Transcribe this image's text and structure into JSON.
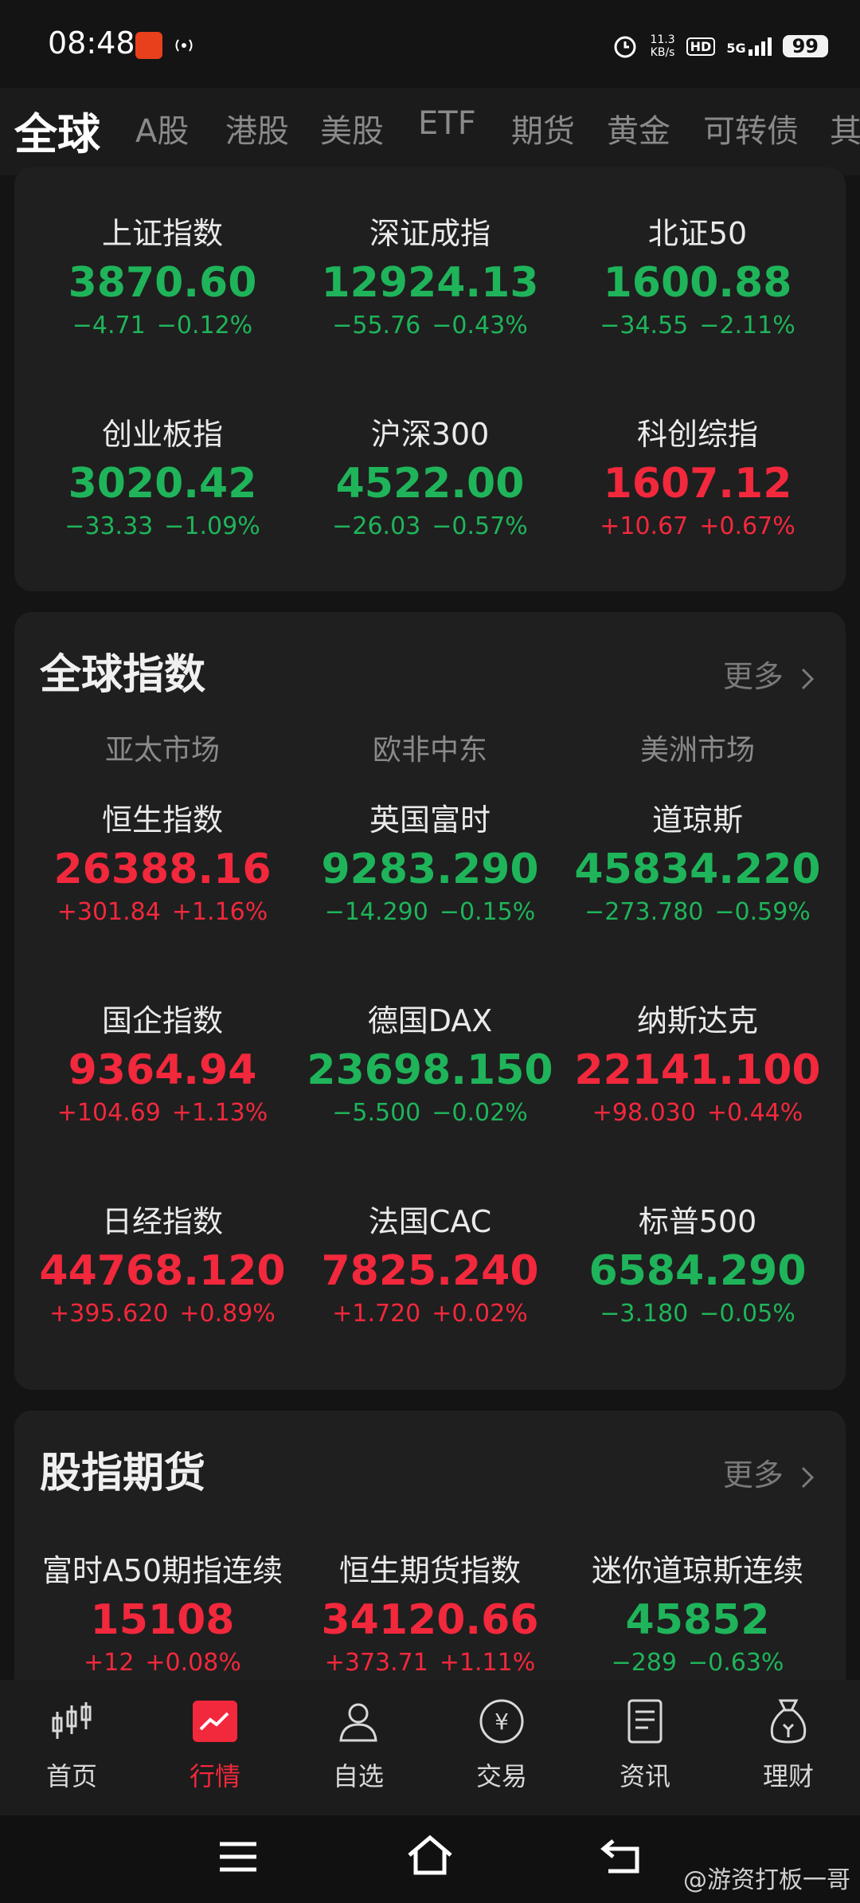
{
  "status": {
    "time": "08:48",
    "net_speed": "11.3",
    "net_unit": "KB/s",
    "hd": "HD",
    "net_type": "5G",
    "battery": "99"
  },
  "tabs": [
    "全球",
    "A股",
    "港股",
    "美股",
    "ETF",
    "期货",
    "黄金",
    "可转债",
    "其"
  ],
  "cn_indices": [
    {
      "name": "上证指数",
      "value": "3870.60",
      "change": "−4.71",
      "pct": "−0.12%",
      "dir": "dn"
    },
    {
      "name": "深证成指",
      "value": "12924.13",
      "change": "−55.76",
      "pct": "−0.43%",
      "dir": "dn"
    },
    {
      "name": "北证50",
      "value": "1600.88",
      "change": "−34.55",
      "pct": "−2.11%",
      "dir": "dn"
    },
    {
      "name": "创业板指",
      "value": "3020.42",
      "change": "−33.33",
      "pct": "−1.09%",
      "dir": "dn"
    },
    {
      "name": "沪深300",
      "value": "4522.00",
      "change": "−26.03",
      "pct": "−0.57%",
      "dir": "dn"
    },
    {
      "name": "科创综指",
      "value": "1607.12",
      "change": "+10.67",
      "pct": "+0.67%",
      "dir": "up"
    }
  ],
  "global": {
    "title": "全球指数",
    "more": "更多",
    "regions": [
      "亚太市场",
      "欧非中东",
      "美洲市场"
    ],
    "items": [
      {
        "name": "恒生指数",
        "value": "26388.16",
        "change": "+301.84",
        "pct": "+1.16%",
        "dir": "up"
      },
      {
        "name": "英国富时",
        "value": "9283.290",
        "change": "−14.290",
        "pct": "−0.15%",
        "dir": "dn"
      },
      {
        "name": "道琼斯",
        "value": "45834.220",
        "change": "−273.780",
        "pct": "−0.59%",
        "dir": "dn"
      },
      {
        "name": "国企指数",
        "value": "9364.94",
        "change": "+104.69",
        "pct": "+1.13%",
        "dir": "up"
      },
      {
        "name": "德国DAX",
        "value": "23698.150",
        "change": "−5.500",
        "pct": "−0.02%",
        "dir": "dn"
      },
      {
        "name": "纳斯达克",
        "value": "22141.100",
        "change": "+98.030",
        "pct": "+0.44%",
        "dir": "up"
      },
      {
        "name": "日经指数",
        "value": "44768.120",
        "change": "+395.620",
        "pct": "+0.89%",
        "dir": "up"
      },
      {
        "name": "法国CAC",
        "value": "7825.240",
        "change": "+1.720",
        "pct": "+0.02%",
        "dir": "up"
      },
      {
        "name": "标普500",
        "value": "6584.290",
        "change": "−3.180",
        "pct": "−0.05%",
        "dir": "dn"
      }
    ]
  },
  "futures": {
    "title": "股指期货",
    "more": "更多",
    "items": [
      {
        "name": "富时A50期指连续",
        "value": "15108",
        "change": "+12",
        "pct": "+0.08%",
        "dir": "up"
      },
      {
        "name": "恒生期货指数",
        "value": "34120.66",
        "change": "+373.71",
        "pct": "+1.11%",
        "dir": "up"
      },
      {
        "name": "迷你道琼斯连续",
        "value": "45852",
        "change": "−289",
        "pct": "−0.63%",
        "dir": "dn"
      }
    ]
  },
  "nav": [
    {
      "label": "首页",
      "icon": "candlestick-icon"
    },
    {
      "label": "行情",
      "icon": "market-chart-icon",
      "active": true
    },
    {
      "label": "自选",
      "icon": "user-watchlist-icon"
    },
    {
      "label": "交易",
      "icon": "yuan-coin-icon"
    },
    {
      "label": "资讯",
      "icon": "news-document-icon"
    },
    {
      "label": "理财",
      "icon": "money-bag-icon"
    }
  ],
  "watermark": "@游资打板一哥",
  "colors": {
    "up": "#f2283c",
    "down": "#1fb45a",
    "background": "#141414",
    "card": "#1f1f1f"
  }
}
